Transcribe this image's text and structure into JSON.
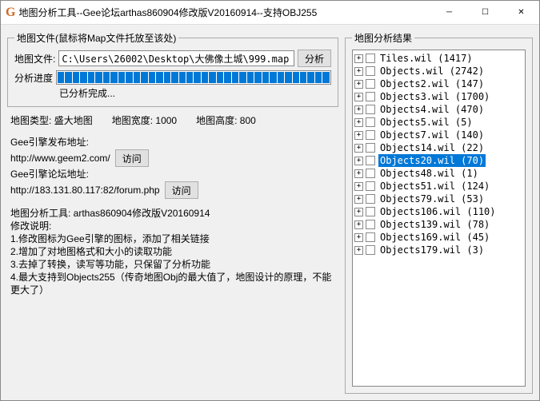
{
  "window": {
    "title": "地图分析工具--Gee论坛arthas860904修改版V20160914--支持OBJ255"
  },
  "file_group": {
    "legend": "地图文件(鼠标将Map文件托放至该处)",
    "file_label": "地图文件:",
    "file_value": "C:\\Users\\26002\\Desktop\\大佛像土城\\999.map",
    "analyze_btn": "分析",
    "progress_label": "分析进度",
    "status": "已分析完成..."
  },
  "map_info": {
    "type_label": "地图类型:",
    "type_value": "盛大地图",
    "width_label": "地图宽度:",
    "width_value": "1000",
    "height_label": "地图高度:",
    "height_value": "800"
  },
  "links": {
    "publish_title": "Gee引擎发布地址:",
    "url1": "http://www.geem2.com/",
    "forum_title": "Gee引擎论坛地址:",
    "url2": "http://183.131.80.117:82/forum.php",
    "visit_btn": "访问"
  },
  "tool_info": {
    "title": "地图分析工具: arthas860904修改版V20160914",
    "desc_title": "修改说明:",
    "line1": "1.修改图标为Gee引擎的图标，添加了相关链接",
    "line2": "2.增加了对地图格式和大小的读取功能",
    "line3": "3.去掉了转换，读写等功能，只保留了分析功能",
    "line4": "4.最大支持到Objects255（传奇地图Obj的最大值了，地图设计的原理，不能更大了）"
  },
  "results": {
    "legend": "地图分析结果",
    "items": [
      {
        "label": "Tiles.wil (1417)",
        "selected": false
      },
      {
        "label": "Objects.wil (2742)",
        "selected": false
      },
      {
        "label": "Objects2.wil (147)",
        "selected": false
      },
      {
        "label": "Objects3.wil (1700)",
        "selected": false
      },
      {
        "label": "Objects4.wil (470)",
        "selected": false
      },
      {
        "label": "Objects5.wil (5)",
        "selected": false
      },
      {
        "label": "Objects7.wil (140)",
        "selected": false
      },
      {
        "label": "Objects14.wil (22)",
        "selected": false
      },
      {
        "label": "Objects20.wil (70)",
        "selected": true
      },
      {
        "label": "Objects48.wil (1)",
        "selected": false
      },
      {
        "label": "Objects51.wil (124)",
        "selected": false
      },
      {
        "label": "Objects79.wil (53)",
        "selected": false
      },
      {
        "label": "Objects106.wil (110)",
        "selected": false
      },
      {
        "label": "Objects139.wil (78)",
        "selected": false
      },
      {
        "label": "Objects169.wil (45)",
        "selected": false
      },
      {
        "label": "Objects179.wil (3)",
        "selected": false
      }
    ]
  }
}
